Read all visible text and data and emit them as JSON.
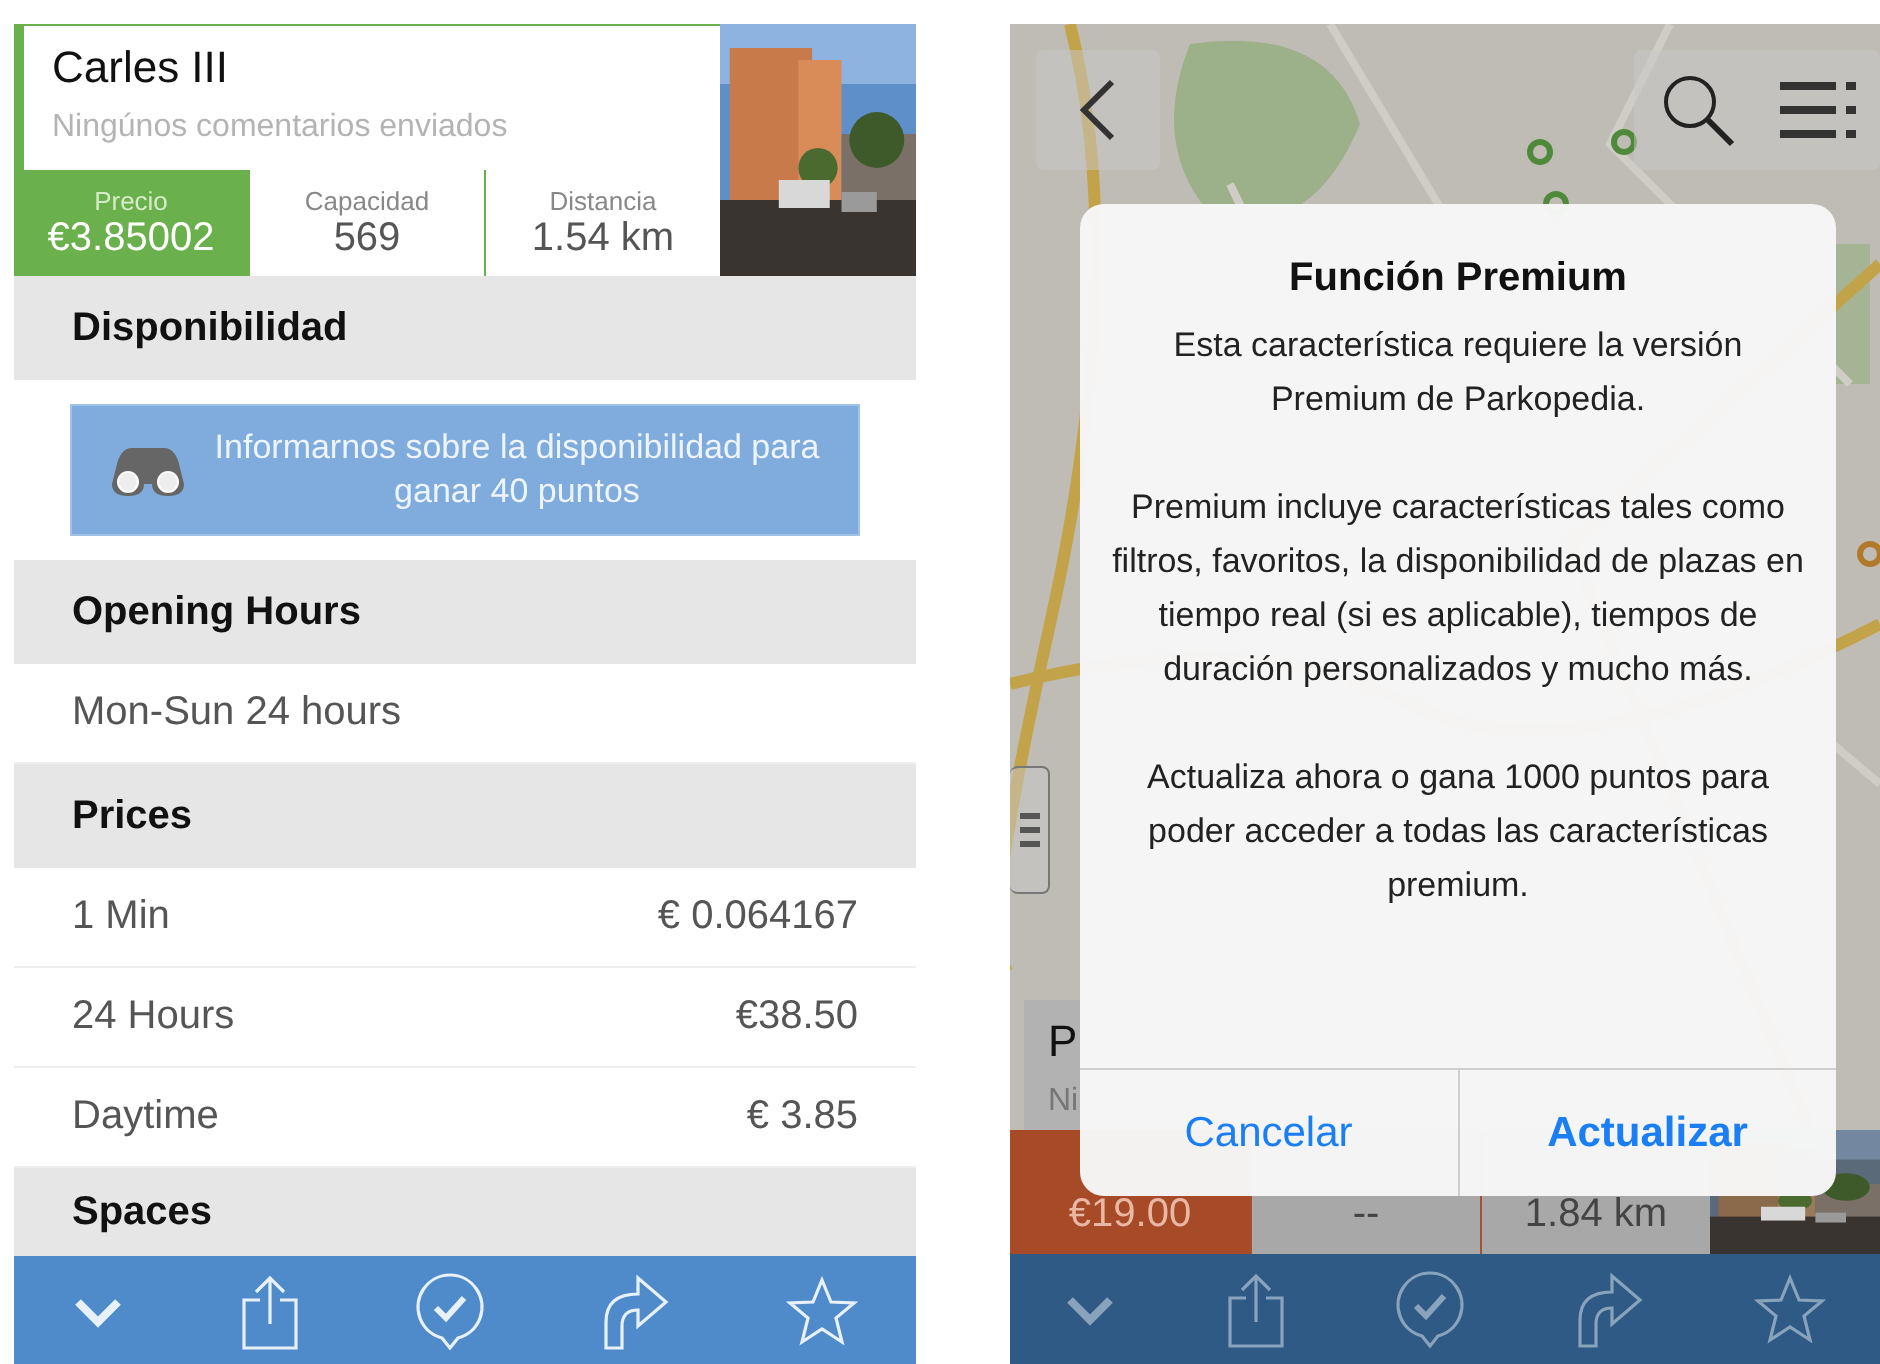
{
  "detail_screen": {
    "header": {
      "title": "Carles III",
      "subtitle": "Ningúnos comentarios enviados"
    },
    "stats": [
      {
        "label": "Precio",
        "value": "€3.85002",
        "highlighted": true
      },
      {
        "label": "Capacidad",
        "value": "569",
        "highlighted": false
      },
      {
        "label": "Distancia",
        "value": "1.54 km",
        "highlighted": false
      }
    ],
    "sections": [
      {
        "kind": "header",
        "text": "Disponibilidad"
      },
      {
        "kind": "action",
        "text": "Informarnos sobre la disponibilidad para ganar 40 puntos"
      },
      {
        "kind": "header",
        "text": "Opening Hours"
      },
      {
        "kind": "row",
        "label": "Mon-Sun 24 hours"
      },
      {
        "kind": "header",
        "text": "Prices"
      },
      {
        "kind": "row",
        "label": "1 Min",
        "value": "€ 0.064167"
      },
      {
        "kind": "row",
        "label": "24 Hours",
        "value": "€38.50"
      },
      {
        "kind": "row",
        "label": "Daytime",
        "value": "€ 3.85"
      },
      {
        "kind": "header",
        "text": "Spaces"
      }
    ]
  },
  "map_screen": {
    "card": {
      "title": "P",
      "subtitle": "Ni"
    },
    "stats": [
      {
        "value": "€19.00",
        "highlighted": true
      },
      {
        "value": "--",
        "highlighted": false
      },
      {
        "value": "1.84 km",
        "highlighted": false
      }
    ],
    "dialog": {
      "title": "Función Premium",
      "paragraphs": [
        "Esta característica requiere la versión Premium de Parkopedia.",
        "Premium incluye características tales como filtros, favoritos, la disponibilidad de plazas en tiempo real (si es aplicable),  tiempos de duración personalizados y mucho más.",
        "Actualiza ahora o gana 1000 puntos para poder acceder a todas las características premium."
      ],
      "buttons": [
        {
          "label": "Cancelar",
          "primary": false
        },
        {
          "label": "Actualizar",
          "primary": true
        }
      ]
    }
  }
}
